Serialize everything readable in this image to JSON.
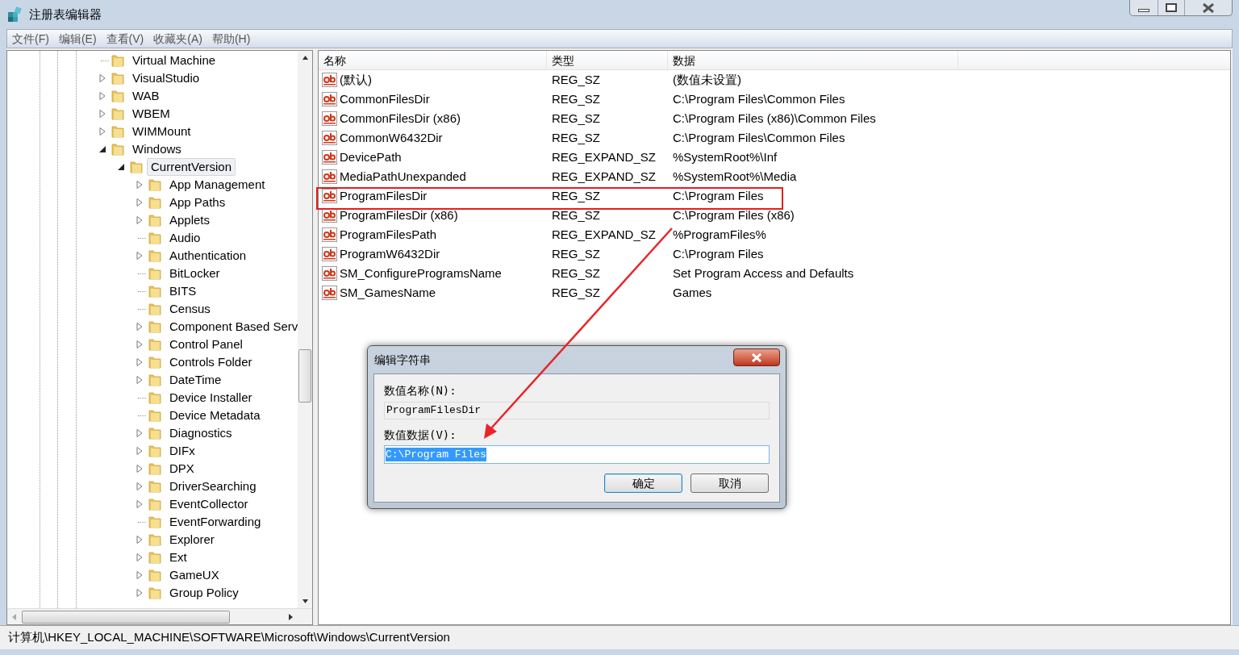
{
  "window": {
    "title": "注册表编辑器"
  },
  "menu": [
    "文件(F)",
    "编辑(E)",
    "查看(V)",
    "收藏夹(A)",
    "帮助(H)"
  ],
  "tree": [
    {
      "label": "Virtual Machine",
      "expandable": false,
      "selected": false
    },
    {
      "label": "VisualStudio",
      "expandable": true,
      "expanded": false,
      "selected": false
    },
    {
      "label": "WAB",
      "expandable": true,
      "expanded": false,
      "selected": false
    },
    {
      "label": "WBEM",
      "expandable": true,
      "expanded": false,
      "selected": false
    },
    {
      "label": "WIMMount",
      "expandable": true,
      "expanded": false,
      "selected": false
    },
    {
      "label": "Windows",
      "expandable": true,
      "expanded": true,
      "selected": false,
      "children": [
        {
          "label": "CurrentVersion",
          "expandable": true,
          "expanded": true,
          "selected": true,
          "children": [
            {
              "label": "App Management",
              "expandable": true,
              "expanded": false,
              "selected": false
            },
            {
              "label": "App Paths",
              "expandable": true,
              "expanded": false,
              "selected": false
            },
            {
              "label": "Applets",
              "expandable": true,
              "expanded": false,
              "selected": false
            },
            {
              "label": "Audio",
              "expandable": false,
              "selected": false
            },
            {
              "label": "Authentication",
              "expandable": true,
              "expanded": false,
              "selected": false
            },
            {
              "label": "BitLocker",
              "expandable": false,
              "selected": false
            },
            {
              "label": "BITS",
              "expandable": false,
              "selected": false
            },
            {
              "label": "Census",
              "expandable": false,
              "selected": false
            },
            {
              "label": "Component Based Serv",
              "expandable": true,
              "expanded": false,
              "selected": false
            },
            {
              "label": "Control Panel",
              "expandable": true,
              "expanded": false,
              "selected": false
            },
            {
              "label": "Controls Folder",
              "expandable": true,
              "expanded": false,
              "selected": false
            },
            {
              "label": "DateTime",
              "expandable": true,
              "expanded": false,
              "selected": false
            },
            {
              "label": "Device Installer",
              "expandable": false,
              "selected": false
            },
            {
              "label": "Device Metadata",
              "expandable": false,
              "selected": false
            },
            {
              "label": "Diagnostics",
              "expandable": true,
              "expanded": false,
              "selected": false
            },
            {
              "label": "DIFx",
              "expandable": true,
              "expanded": false,
              "selected": false
            },
            {
              "label": "DPX",
              "expandable": true,
              "expanded": false,
              "selected": false
            },
            {
              "label": "DriverSearching",
              "expandable": true,
              "expanded": false,
              "selected": false
            },
            {
              "label": "EventCollector",
              "expandable": true,
              "expanded": false,
              "selected": false
            },
            {
              "label": "EventForwarding",
              "expandable": false,
              "selected": false
            },
            {
              "label": "Explorer",
              "expandable": true,
              "expanded": false,
              "selected": false
            },
            {
              "label": "Ext",
              "expandable": true,
              "expanded": false,
              "selected": false
            },
            {
              "label": "GameUX",
              "expandable": true,
              "expanded": false,
              "selected": false
            },
            {
              "label": "Group Policy",
              "expandable": true,
              "expanded": false,
              "selected": false
            }
          ]
        }
      ]
    }
  ],
  "values": {
    "columns": [
      "名称",
      "类型",
      "数据"
    ],
    "rows": [
      {
        "name": "(默认)",
        "type": "REG_SZ",
        "data": "(数值未设置)"
      },
      {
        "name": "CommonFilesDir",
        "type": "REG_SZ",
        "data": "C:\\Program Files\\Common Files"
      },
      {
        "name": "CommonFilesDir (x86)",
        "type": "REG_SZ",
        "data": "C:\\Program Files (x86)\\Common Files"
      },
      {
        "name": "CommonW6432Dir",
        "type": "REG_SZ",
        "data": "C:\\Program Files\\Common Files"
      },
      {
        "name": "DevicePath",
        "type": "REG_EXPAND_SZ",
        "data": "%SystemRoot%\\Inf"
      },
      {
        "name": "MediaPathUnexpanded",
        "type": "REG_EXPAND_SZ",
        "data": "%SystemRoot%\\Media"
      },
      {
        "name": "ProgramFilesDir",
        "type": "REG_SZ",
        "data": "C:\\Program Files"
      },
      {
        "name": "ProgramFilesDir (x86)",
        "type": "REG_SZ",
        "data": "C:\\Program Files (x86)"
      },
      {
        "name": "ProgramFilesPath",
        "type": "REG_EXPAND_SZ",
        "data": "%ProgramFiles%"
      },
      {
        "name": "ProgramW6432Dir",
        "type": "REG_SZ",
        "data": "C:\\Program Files"
      },
      {
        "name": "SM_ConfigureProgramsName",
        "type": "REG_SZ",
        "data": "Set Program Access and Defaults"
      },
      {
        "name": "SM_GamesName",
        "type": "REG_SZ",
        "data": "Games"
      }
    ]
  },
  "status_bar": "计算机\\HKEY_LOCAL_MACHINE\\SOFTWARE\\Microsoft\\Windows\\CurrentVersion",
  "dialog": {
    "title": "编辑字符串",
    "name_label": "数值名称(N):",
    "name_value": "ProgramFilesDir",
    "data_label": "数值数据(V):",
    "data_value": "C:\\Program Files",
    "buttons": [
      "确定",
      "取消"
    ]
  }
}
